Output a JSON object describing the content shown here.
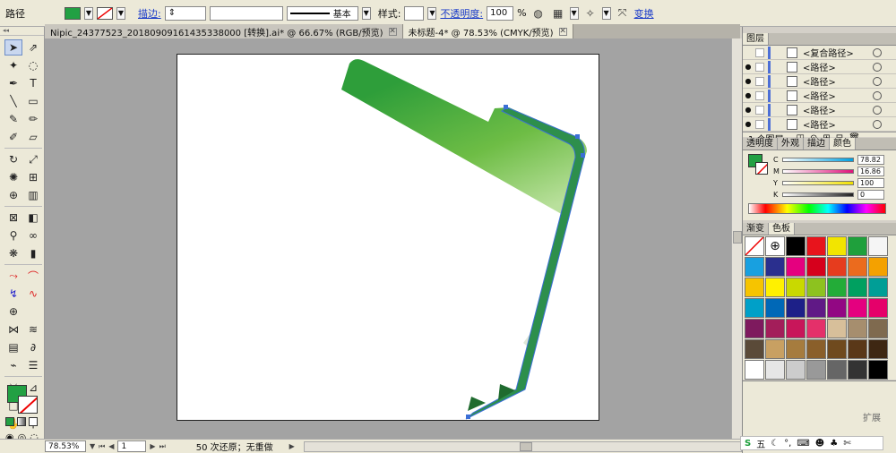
{
  "control_bar": {
    "object_type": "路径",
    "fill_color": "#22a043",
    "stroke_label": "描边:",
    "stroke_profile": "基本",
    "style_label": "样式:",
    "opacity_label": "不透明度:",
    "opacity_value": "100",
    "opacity_unit": "%",
    "transform_label": "变换"
  },
  "doc_tabs": [
    {
      "label": "Nipic_24377523_20180909161435338000  [转换].ai* @ 66.67% (RGB/预览)"
    },
    {
      "label": "未标题-4* @ 78.53% (CMYK/预览)"
    }
  ],
  "status_bar": {
    "zoom": "78.53%",
    "page": "1",
    "undo_status": "50 次还原；无重做"
  },
  "layers": {
    "tab": "图层",
    "rows": [
      {
        "name": "<复合路径>"
      },
      {
        "name": "<路径>"
      },
      {
        "name": "<路径>"
      },
      {
        "name": "<路径>"
      },
      {
        "name": "<路径>"
      },
      {
        "name": "<路径>"
      }
    ],
    "footer": "1 个图层"
  },
  "color_panel": {
    "tabs": [
      "透明度",
      "外观",
      "描边",
      "颜色"
    ],
    "active_tab": "颜色",
    "sliders": [
      {
        "label": "C",
        "value": "78.82",
        "color": "#00a0e0"
      },
      {
        "label": "M",
        "value": "16.86",
        "color": "#e0107a"
      },
      {
        "label": "Y",
        "value": "100",
        "color": "#f0e000"
      },
      {
        "label": "K",
        "value": "0",
        "color": "#222222"
      }
    ]
  },
  "swatches_panel": {
    "tabs": [
      "渐变",
      "色板"
    ],
    "active_tab": "色板",
    "colors": [
      "#ffffff",
      "#ffffff",
      "#000000",
      "#e8141c",
      "#f2e500",
      "#1fa03c",
      "#f5f5f5",
      "#18a0e0",
      "#2a2f8e",
      "#e5007f",
      "#d6001c",
      "#e63c1e",
      "#eb6b1e",
      "#f4a100",
      "#f6c400",
      "#fff100",
      "#c9d900",
      "#8dc21f",
      "#23ac38",
      "#00a060",
      "#009e96",
      "#00a0c8",
      "#0068b7",
      "#1d2088",
      "#601986",
      "#920783",
      "#e4007f",
      "#e5006a",
      "#7e1a5e",
      "#a31e5a",
      "#c8165a",
      "#e4306a",
      "#d7bf9a",
      "#a68e6e",
      "#7f6a4f",
      "#5a4a38",
      "#c8a062",
      "#a67c3e",
      "#8a5f2a",
      "#6f4a1e",
      "#5a3818",
      "#3e2712",
      "#ffffff",
      "#e6e6e6",
      "#cccccc",
      "#999999",
      "#666666",
      "#333333",
      "#000000"
    ]
  },
  "bottom_panel": {
    "expand_label": "扩展"
  },
  "taskbar": {
    "ime": "五"
  }
}
